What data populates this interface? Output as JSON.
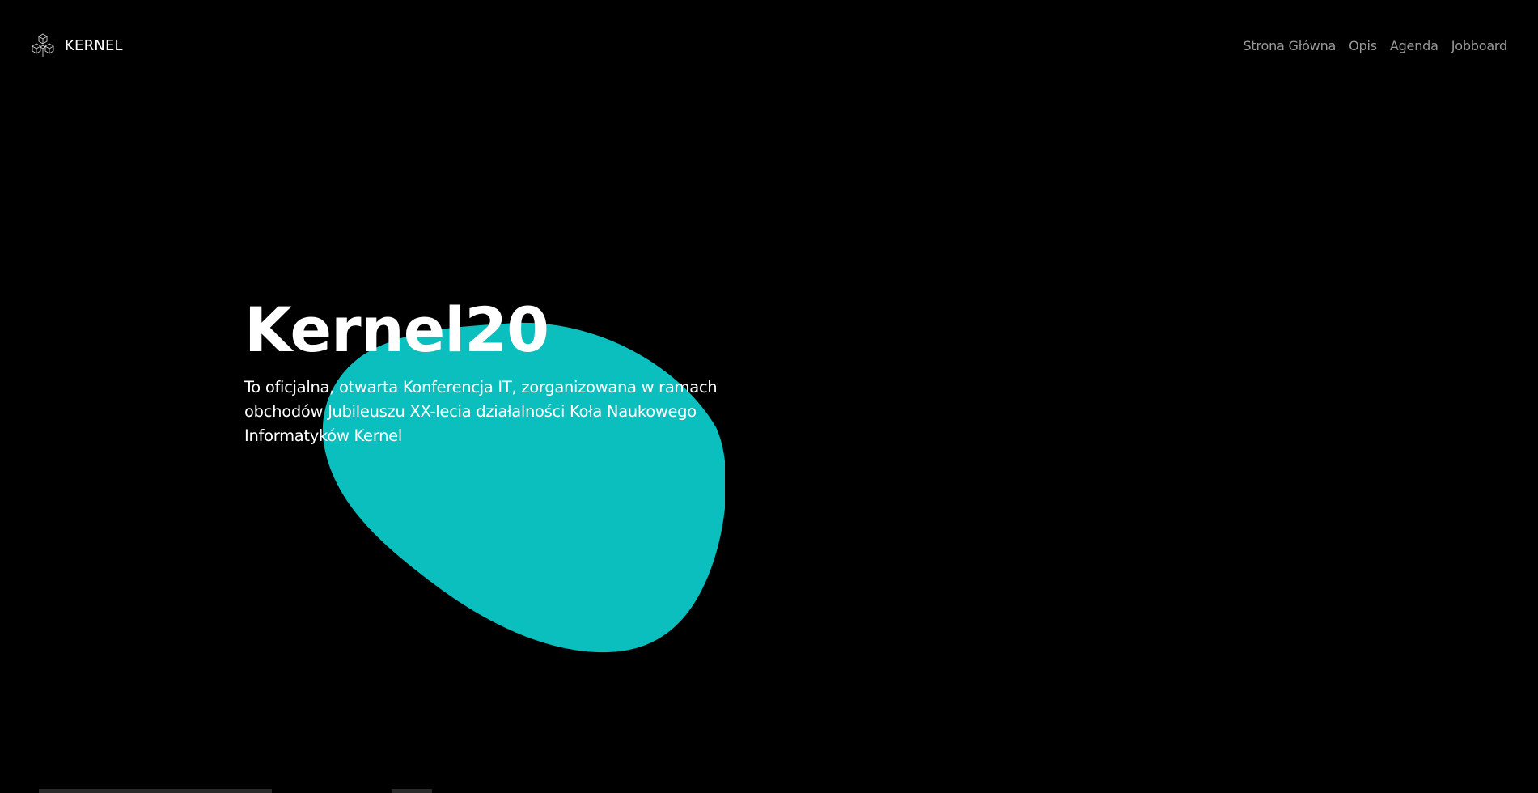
{
  "header": {
    "brand": {
      "logo_icon": "kernel-cubes-logo",
      "name": "KERNEL"
    },
    "nav": [
      {
        "label": "Strona Główna"
      },
      {
        "label": "Opis"
      },
      {
        "label": "Agenda"
      },
      {
        "label": "Jobboard"
      }
    ]
  },
  "hero": {
    "title": "Kernel20",
    "description": "To oficjalna, otwarta Konferencja IT, zorganizowana w ramach obchodów Jubileuszu XX-lecia działalności Koła Naukowego Informatyków Kernel"
  },
  "colors": {
    "background": "#000000",
    "accent_blob": "#0bbfbe",
    "text": "#ffffff",
    "nav_text": "#9a9a9a"
  }
}
